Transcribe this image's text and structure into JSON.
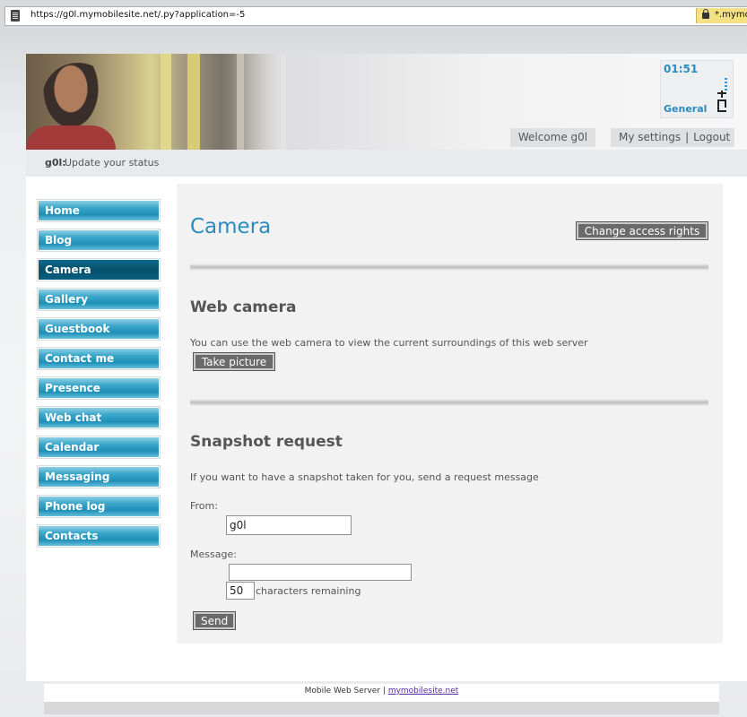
{
  "browser": {
    "url": "https://g0l.mymobilesite.net/.py?application=-5",
    "secure_label": "*.mymob"
  },
  "header": {
    "time": "01:51",
    "profile": "General",
    "welcome": "Welcome g0l",
    "my_settings": "My settings",
    "separator": "|",
    "logout": "Logout"
  },
  "status": {
    "user": "g0l:",
    "text": "Update your status"
  },
  "nav": {
    "items": [
      {
        "label": "Home"
      },
      {
        "label": "Blog"
      },
      {
        "label": "Camera"
      },
      {
        "label": "Gallery"
      },
      {
        "label": "Guestbook"
      },
      {
        "label": "Contact me"
      },
      {
        "label": "Presence"
      },
      {
        "label": "Web chat"
      },
      {
        "label": "Calendar"
      },
      {
        "label": "Messaging"
      },
      {
        "label": "Phone log"
      },
      {
        "label": "Contacts"
      }
    ],
    "active": "Camera"
  },
  "main": {
    "title": "Camera",
    "access_button": "Change access rights",
    "webcam": {
      "heading": "Web camera",
      "description": "You can use the web camera to view the current surroundings of this web server",
      "button": "Take picture"
    },
    "snapshot": {
      "heading": "Snapshot request",
      "description": "If you want to have a snapshot taken for you, send a request message",
      "from_label": "From:",
      "from_value": "g0l",
      "message_label": "Message:",
      "message_value": "",
      "remaining_value": "50",
      "remaining_label": "characters remaining",
      "send_button": "Send"
    }
  },
  "footer": {
    "text": "Mobile Web Server |",
    "link": "mymobilesite.net"
  },
  "colors": {
    "accent": "#2a8bbf",
    "nav_active": "#05506c"
  }
}
